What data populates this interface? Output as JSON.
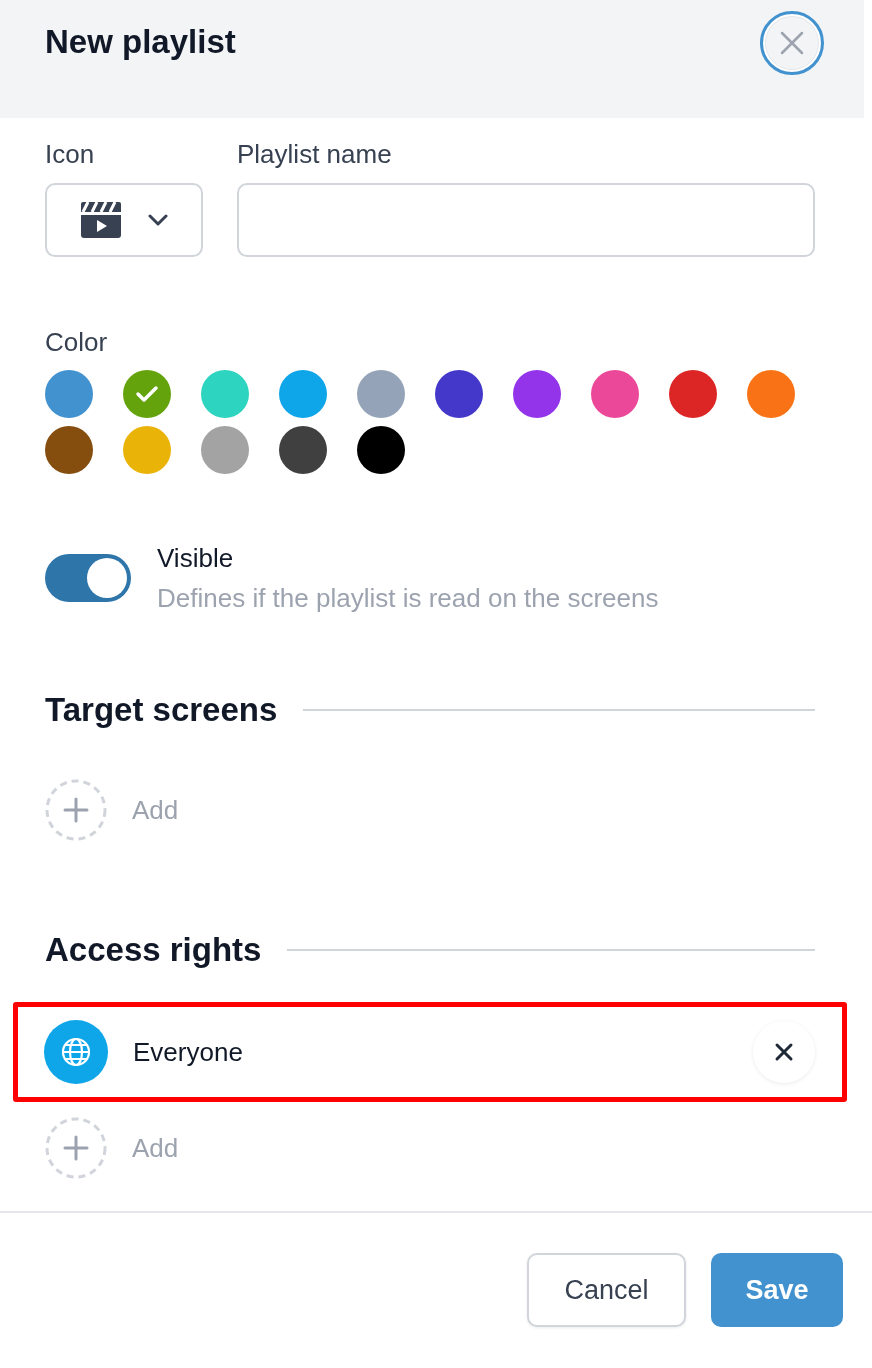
{
  "header": {
    "title": "New playlist",
    "close": {
      "focused": true
    }
  },
  "fields": [
    {
      "label": "Icon",
      "kind": "icon-select"
    },
    {
      "label": "Playlist name",
      "kind": "text"
    }
  ],
  "color_picker": {
    "label": "Color",
    "colors": [
      {
        "color": "#4192cf",
        "selected": false
      },
      {
        "color": "#65a30d",
        "selected": true
      },
      {
        "color": "#2dd4bf",
        "selected": false
      },
      {
        "color": "#0ea5e9",
        "selected": false
      },
      {
        "color": "#94a3b8",
        "selected": false
      },
      {
        "color": "#4338ca",
        "selected": false
      },
      {
        "color": "#9333ea",
        "selected": false
      },
      {
        "color": "#ec4899",
        "selected": false
      },
      {
        "color": "#dc2626",
        "selected": false
      },
      {
        "color": "#f97316",
        "selected": false
      },
      {
        "color": "#854d0e",
        "selected": false
      },
      {
        "color": "#eab308",
        "selected": false
      },
      {
        "color": "#a3a3a3",
        "selected": false
      },
      {
        "color": "#404040",
        "selected": false
      },
      {
        "color": "#000000",
        "selected": false
      }
    ]
  },
  "visibility": {
    "label": "Visible",
    "description": "Defines if the playlist is read on the screens",
    "on": true
  },
  "target_screens": {
    "title": "Target screens",
    "add_label": "Add"
  },
  "access_rights": {
    "title": "Access rights",
    "entries": [
      {
        "label": "Everyone",
        "highlighted": true
      }
    ],
    "add_label": "Add"
  },
  "footer": {
    "buttons": [
      {
        "label": "Cancel",
        "kind": "secondary"
      },
      {
        "label": "Save",
        "kind": "primary"
      }
    ]
  }
}
